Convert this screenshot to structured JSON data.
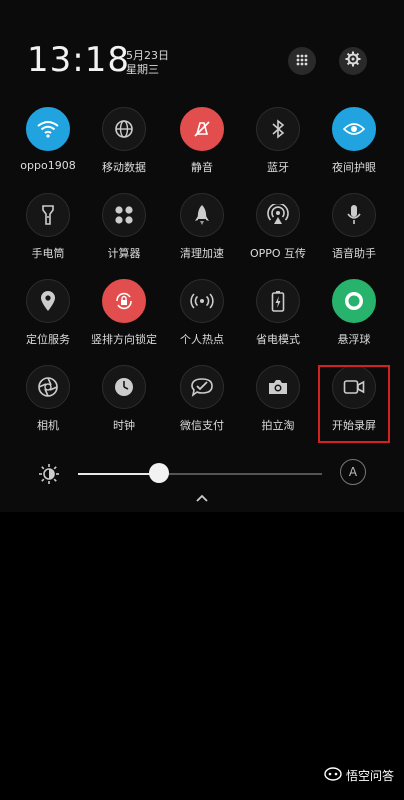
{
  "header": {
    "time": "13:18",
    "date": "5月23日",
    "weekday": "星期三"
  },
  "top_actions": [
    "grid-icon",
    "gear-icon"
  ],
  "tiles": [
    {
      "label": "oppo1908",
      "icon": "wifi-icon",
      "state": "on",
      "color": "#21a3e0"
    },
    {
      "label": "移动数据",
      "icon": "globe-icon",
      "state": "off"
    },
    {
      "label": "静音",
      "icon": "mute-icon",
      "state": "on",
      "color": "#e24e4e"
    },
    {
      "label": "蓝牙",
      "icon": "bluetooth-icon",
      "state": "off"
    },
    {
      "label": "夜间护眼",
      "icon": "eye-icon",
      "state": "on",
      "color": "#21a3e0"
    },
    {
      "label": "手电筒",
      "icon": "flashlight-icon",
      "state": "off"
    },
    {
      "label": "计算器",
      "icon": "calculator-icon",
      "state": "off"
    },
    {
      "label": "清理加速",
      "icon": "rocket-icon",
      "state": "off"
    },
    {
      "label": "OPPO 互传",
      "icon": "transfer-icon",
      "state": "off"
    },
    {
      "label": "语音助手",
      "icon": "mic-icon",
      "state": "off"
    },
    {
      "label": "定位服务",
      "icon": "location-icon",
      "state": "off"
    },
    {
      "label": "竖排方向锁定",
      "icon": "rotation-lock-icon",
      "state": "on",
      "color": "#e24e4e"
    },
    {
      "label": "个人热点",
      "icon": "hotspot-icon",
      "state": "off"
    },
    {
      "label": "省电模式",
      "icon": "battery-icon",
      "state": "off"
    },
    {
      "label": "悬浮球",
      "icon": "float-ball-icon",
      "state": "on",
      "color": "#27b36b"
    },
    {
      "label": "相机",
      "icon": "camera-aperture-icon",
      "state": "off"
    },
    {
      "label": "时钟",
      "icon": "clock-icon",
      "state": "off"
    },
    {
      "label": "微信支付",
      "icon": "wechat-pay-icon",
      "state": "off"
    },
    {
      "label": "拍立淘",
      "icon": "photo-camera-icon",
      "state": "off"
    },
    {
      "label": "开始录屏",
      "icon": "screen-record-icon",
      "state": "off",
      "highlighted": true
    }
  ],
  "brightness": {
    "level": 0.33,
    "auto_label": "A"
  },
  "watermark": {
    "text": "悟空问答"
  }
}
